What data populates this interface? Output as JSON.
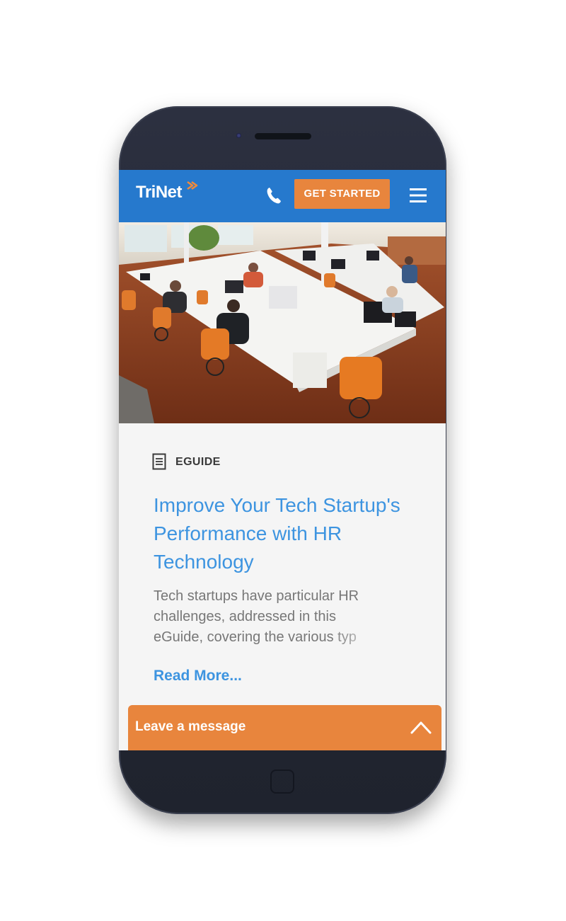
{
  "header": {
    "logo_text": "TriNet",
    "cta_label": "GET STARTED",
    "brand_color": "#2679cd",
    "accent_color": "#e8853d"
  },
  "article": {
    "type_label": "EGUIDE",
    "title": "Improve Your Tech Startup's Performance with HR Technology",
    "excerpt": "Tech startups have particular HR challenges, addressed in this eGuide, covering the various typ",
    "read_more": "Read More..."
  },
  "chat": {
    "label": "Leave a message"
  }
}
